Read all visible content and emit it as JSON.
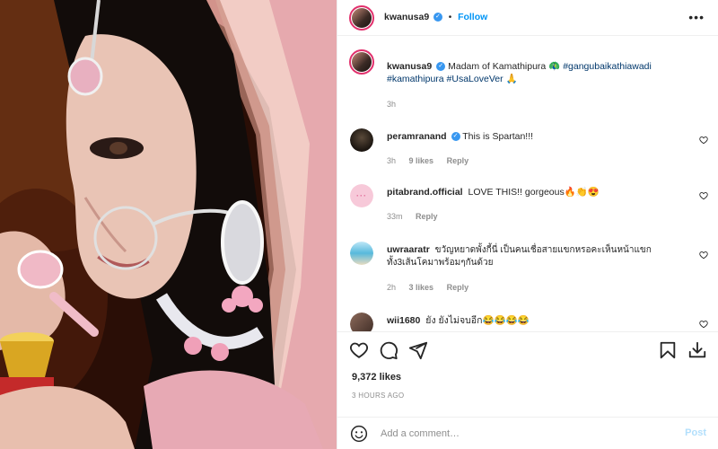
{
  "post": {
    "author": "kwanusa9",
    "follow_label": "Follow",
    "caption_text": "Madam of Kamathipura 🦚",
    "caption_tags_line1": "#gangubaikathiawadi",
    "caption_tags_line2": "#kamathipura #UsaLoveVer 🙏",
    "caption_time": "3h",
    "likes": "9,372 likes",
    "time_ago": "3 HOURS AGO"
  },
  "comments": [
    {
      "user": "peramranand",
      "verified": true,
      "text": "This is Spartan!!!",
      "time": "3h",
      "likes": "9 likes",
      "reply": "Reply"
    },
    {
      "user": "pitabrand.official",
      "verified": false,
      "text": "LOVE THIS!! gorgeous🔥👏😍",
      "time": "33m",
      "likes": "",
      "reply": "Reply"
    },
    {
      "user": "uwraaratr",
      "verified": false,
      "text": "ขวัญหยาดพั้งกี้นี่ เป็นคนเชื่อสายแขกหรอคะเห็นหน้าแขก ทั้ง3เส้นโคมาพร้อมๆกันด้วย",
      "time": "2h",
      "likes": "3 likes",
      "reply": "Reply"
    },
    {
      "user": "wii1680",
      "verified": false,
      "text": "ยัง ยังไม่จบอีก😂😂😂😂"
    }
  ],
  "add_comment": {
    "placeholder": "Add a comment…",
    "post_label": "Post"
  },
  "icons": {
    "header_more": "more-icon",
    "like": "heart-icon",
    "comment": "comment-icon",
    "share": "share-icon",
    "save": "bookmark-icon",
    "download": "download-icon",
    "emoji": "emoji-icon"
  },
  "colors": {
    "accent": "#0095f6",
    "verified": "#3897f0",
    "hashtag": "#00376b",
    "muted": "#8e8e8e",
    "post_disabled": "#b2dffc"
  }
}
